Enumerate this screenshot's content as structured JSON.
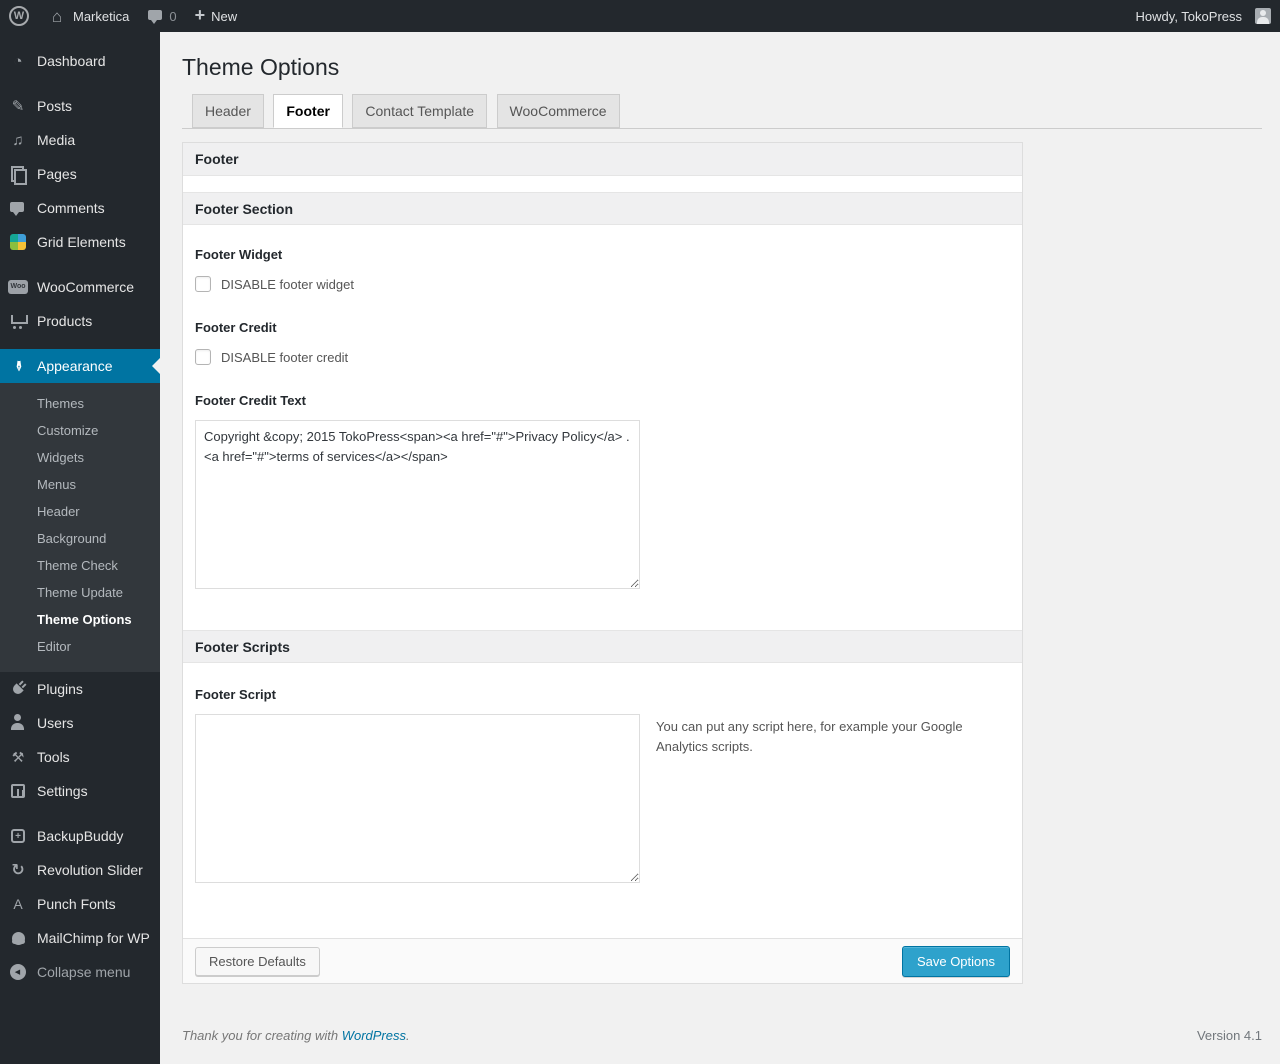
{
  "admin_bar": {
    "site_name": "Marketica",
    "comment_count": "0",
    "new_label": "New",
    "howdy": "Howdy, TokoPress"
  },
  "sidebar": {
    "items": [
      {
        "label": "Dashboard",
        "icon": "dashboard-icon"
      },
      {
        "label": "Posts",
        "icon": "posts-pin-icon"
      },
      {
        "label": "Media",
        "icon": "media-icon"
      },
      {
        "label": "Pages",
        "icon": "pages-icon"
      },
      {
        "label": "Comments",
        "icon": "comments-icon"
      },
      {
        "label": "Grid Elements",
        "icon": "grid-elements-icon"
      },
      {
        "label": "WooCommerce",
        "icon": "woocommerce-icon"
      },
      {
        "label": "Products",
        "icon": "cart-icon"
      },
      {
        "label": "Appearance",
        "icon": "appearance-brush-icon",
        "active": true
      },
      {
        "label": "Plugins",
        "icon": "plugin-icon"
      },
      {
        "label": "Users",
        "icon": "users-icon"
      },
      {
        "label": "Tools",
        "icon": "tools-icon"
      },
      {
        "label": "Settings",
        "icon": "settings-icon"
      },
      {
        "label": "BackupBuddy",
        "icon": "backup-icon"
      },
      {
        "label": "Revolution Slider",
        "icon": "refresh-icon"
      },
      {
        "label": "Punch Fonts",
        "icon": "font-icon"
      },
      {
        "label": "MailChimp for WP",
        "icon": "mailchimp-icon"
      },
      {
        "label": "Collapse menu",
        "icon": "collapse-icon"
      }
    ],
    "appearance_submenu": [
      "Themes",
      "Customize",
      "Widgets",
      "Menus",
      "Header",
      "Background",
      "Theme Check",
      "Theme Update",
      "Theme Options",
      "Editor"
    ],
    "active_item": "Appearance",
    "active_submenu_item": "Theme Options"
  },
  "main": {
    "title": "Theme Options",
    "tabs": [
      {
        "label": "Header",
        "active": false
      },
      {
        "label": "Footer",
        "active": true
      },
      {
        "label": "Contact Template",
        "active": false
      },
      {
        "label": "WooCommerce",
        "active": false
      }
    ]
  },
  "panel": {
    "box_title": "Footer",
    "section_title": "Footer Section",
    "footer_widget_label": "Footer Widget",
    "footer_widget_checkbox_label": "DISABLE footer widget",
    "footer_widget_checked": false,
    "footer_credit_label": "Footer Credit",
    "footer_credit_checkbox_label": "DISABLE footer credit",
    "footer_credit_checked": false,
    "footer_credit_text_label": "Footer Credit Text",
    "footer_credit_text_value": "Copyright &copy; 2015 TokoPress<span><a href=\"#\">Privacy Policy</a> . <a href=\"#\">terms of services</a></span>",
    "scripts_section_title": "Footer Scripts",
    "footer_script_label": "Footer Script",
    "footer_script_value": "",
    "footer_script_hint": "You can put any script here, for example your Google Analytics scripts.",
    "restore_button_label": "Restore Defaults",
    "save_button_label": "Save Options"
  },
  "page_footer": {
    "thanks_text": "Thank you for creating with",
    "thanks_link": "WordPress",
    "thanks_period": ".",
    "version": "Version 4.1"
  },
  "colors": {
    "accent": "#0074a2",
    "primary_button": "#2ea2cc",
    "admin_bar_bg": "#23282d",
    "sidebar_bg": "#23282d",
    "submenu_bg": "#32373c",
    "page_bg": "#f1f1f1"
  }
}
